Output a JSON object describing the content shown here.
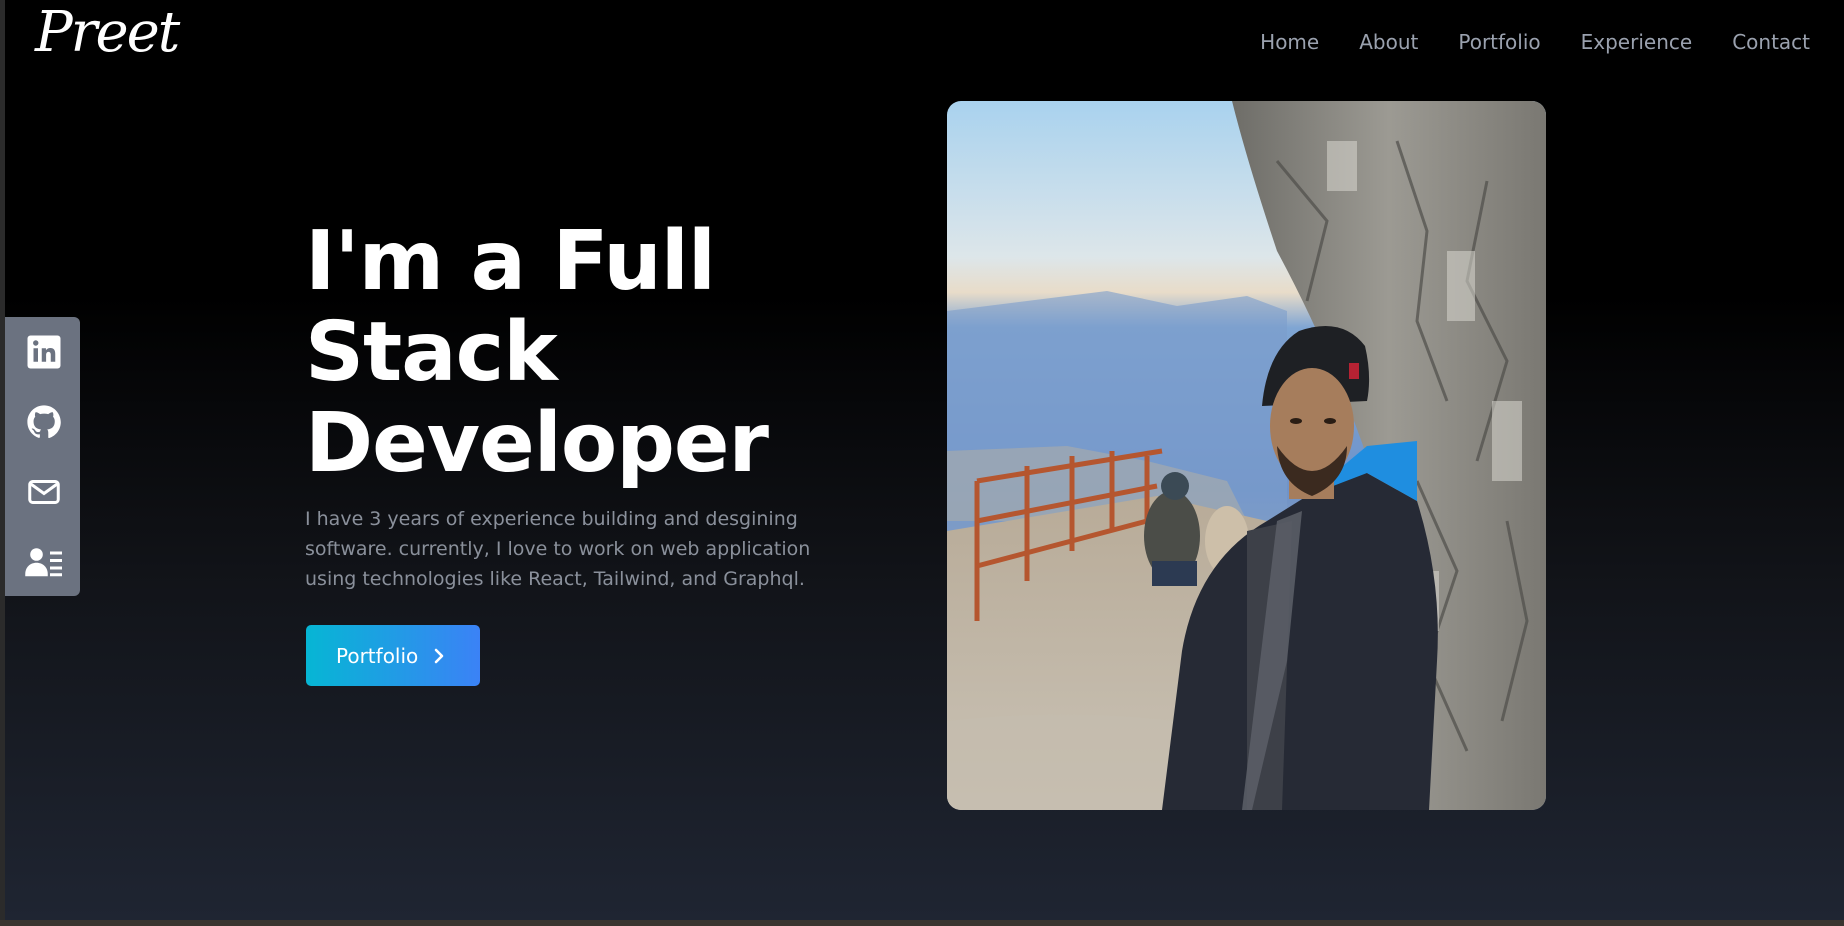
{
  "header": {
    "logo": "Preet",
    "nav": [
      "Home",
      "About",
      "Portfolio",
      "Experience",
      "Contact"
    ]
  },
  "social": {
    "icons": [
      "linkedin-icon",
      "github-icon",
      "mail-icon",
      "resume-icon"
    ],
    "bar_color": "#6b7280"
  },
  "hero": {
    "title_line1": "I'm a Full",
    "title_line2": "Stack",
    "title_line3": "Developer",
    "description": "I have 3 years of experience building and desgining software. currently, I love to work on web application using technologies like React, Tailwind, and Graphql.",
    "button_label": "Portfolio",
    "accent_start": "#06b6d4",
    "accent_end": "#3b82f6"
  }
}
